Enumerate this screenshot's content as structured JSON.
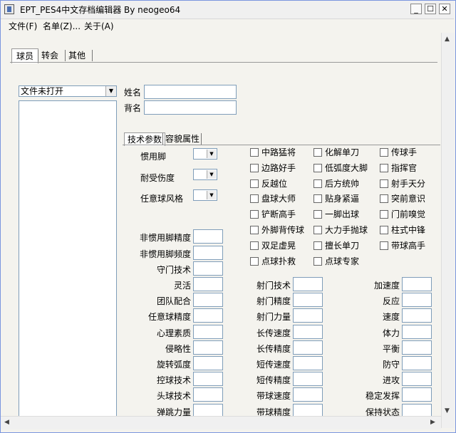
{
  "window": {
    "title": "EPT_PES4中文存档编辑器 By neogeo64",
    "min": "_",
    "max": "☐",
    "close": "✕"
  },
  "menu": [
    "文件(F)",
    "名单(Z)...",
    "关于(A)"
  ],
  "tabs": [
    "球员",
    "转会",
    "其他"
  ],
  "file_combo": {
    "value": "文件未打开"
  },
  "fields": {
    "name_label": "姓名",
    "back_name_label": "背名"
  },
  "inner_tabs": [
    "技术参数",
    "容貌属性"
  ],
  "combos": [
    "惯用脚",
    "耐受伤度",
    "任意球风格"
  ],
  "checkboxes": [
    [
      "中路猛将",
      "化解单刀",
      "传球手"
    ],
    [
      "边路好手",
      "低弧度大脚",
      "指挥官"
    ],
    [
      "反越位",
      "后方统帅",
      "射手天分"
    ],
    [
      "盘球大师",
      "贴身紧逼",
      "突前意识"
    ],
    [
      "铲断高手",
      "一脚出球",
      "门前嗅觉"
    ],
    [
      "外脚背传球",
      "大力手抛球",
      "柱式中锋"
    ],
    [
      "双足虚晃",
      "擅长单刀",
      "带球高手"
    ],
    [
      "点球扑救",
      "点球专家",
      ""
    ]
  ],
  "stats_top": [
    "非惯用脚精度",
    "非惯用脚频度",
    "守门技术"
  ],
  "stats_col1": [
    "灵活",
    "团队配合",
    "任意球精度",
    "心理素质",
    "侵略性",
    "旋转弧度",
    "控球技术",
    "头球技术",
    "弹跳力量"
  ],
  "stats_col2": [
    "射门技术",
    "射门精度",
    "射门力量",
    "长传速度",
    "长传精度",
    "短传速度",
    "短传精度",
    "带球速度",
    "带球精度"
  ],
  "stats_col3": [
    "加速度",
    "反应",
    "速度",
    "体力",
    "平衡",
    "防守",
    "进攻",
    "稳定发挥",
    "保持状态"
  ]
}
